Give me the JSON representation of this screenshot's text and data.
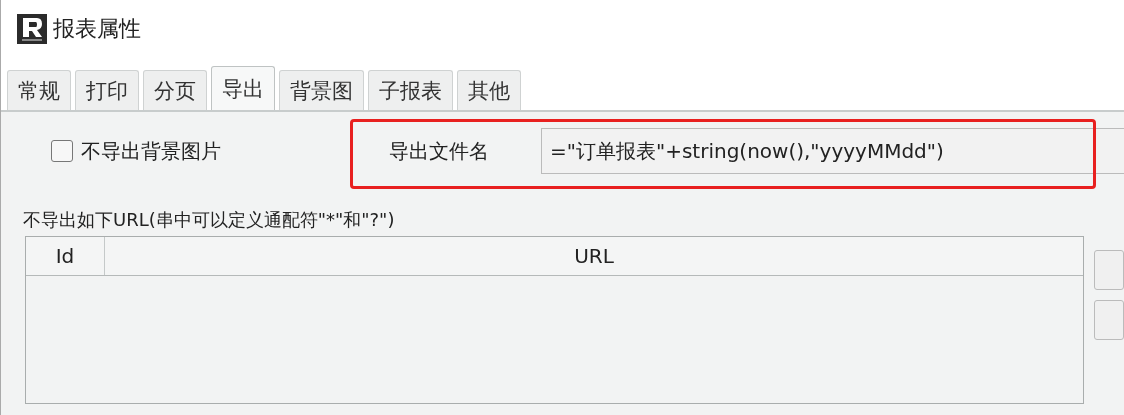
{
  "window": {
    "title": "报表属性"
  },
  "tabs": [
    {
      "label": "常规",
      "selected": false
    },
    {
      "label": "打印",
      "selected": false
    },
    {
      "label": "分页",
      "selected": false
    },
    {
      "label": "导出",
      "selected": true
    },
    {
      "label": "背景图",
      "selected": false
    },
    {
      "label": "子报表",
      "selected": false
    },
    {
      "label": "其他",
      "selected": false
    }
  ],
  "export": {
    "no_background_checkbox": {
      "label": "不导出背景图片",
      "checked": false
    },
    "filename": {
      "label": "导出文件名",
      "value": "=\"订单报表\"+string(now(),\"yyyyMMdd\")",
      "highlighted": true
    },
    "exclude_url_label": "不导出如下URL(串中可以定义通配符\"*\"和\"?\")",
    "table": {
      "columns": [
        "Id",
        "URL"
      ]
    }
  }
}
